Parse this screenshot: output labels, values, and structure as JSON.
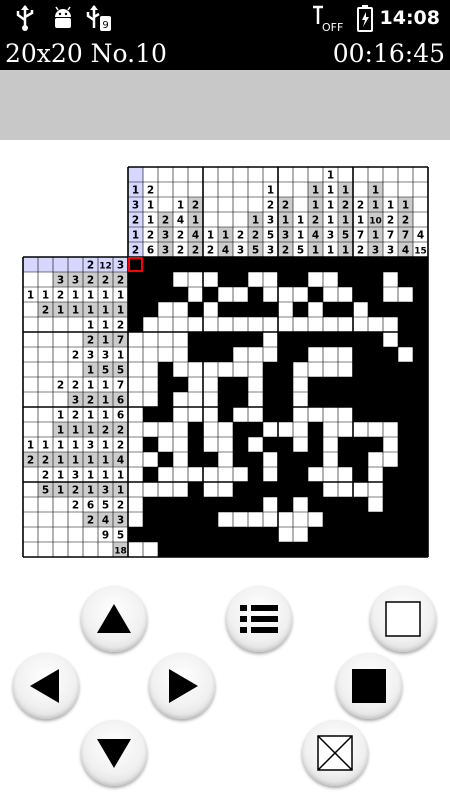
{
  "status_bar": {
    "time": "14:08",
    "icons": [
      "usb-icon",
      "android-debug-icon",
      "usb-storage-icon",
      "wifi-off-icon",
      "battery-charging-icon"
    ]
  },
  "header": {
    "title": "20x20 No.10",
    "timer": "00:16:45"
  },
  "board": {
    "size": 20,
    "column_clues": [
      [
        "1",
        "3",
        "2",
        "1",
        "2"
      ],
      [
        "2",
        "1",
        "1",
        "2",
        "6"
      ],
      [
        "2",
        "3",
        "3"
      ],
      [
        "1",
        "4",
        "2",
        "2"
      ],
      [
        "2",
        "1",
        "4",
        "2"
      ],
      [
        "1",
        "2"
      ],
      [
        "1",
        "4"
      ],
      [
        "2",
        "3"
      ],
      [
        "1",
        "2",
        "5"
      ],
      [
        "1",
        "2",
        "3",
        "5",
        "3"
      ],
      [
        "2",
        "1",
        "3",
        "2"
      ],
      [
        "1",
        "1",
        "5"
      ],
      [
        "1",
        "1",
        "2",
        "4",
        "1"
      ],
      [
        "1",
        "1",
        "1",
        "1",
        "3",
        "1"
      ],
      [
        "1",
        "2",
        "1",
        "5",
        "1"
      ],
      [
        "2",
        "1",
        "7",
        "2"
      ],
      [
        "1",
        "1",
        "10",
        "1",
        "3"
      ],
      [
        "1",
        "2",
        "7",
        "3"
      ],
      [
        "1",
        "2",
        "7",
        "4"
      ],
      [
        "4",
        "15"
      ]
    ],
    "row_clues": [
      [
        "2",
        "12",
        "3"
      ],
      [
        "3",
        "3",
        "2",
        "2",
        "2"
      ],
      [
        "1",
        "1",
        "2",
        "1",
        "1",
        "1",
        "1"
      ],
      [
        "2",
        "1",
        "1",
        "1",
        "1",
        "1"
      ],
      [
        "1",
        "1",
        "2"
      ],
      [
        "2",
        "1",
        "7"
      ],
      [
        "2",
        "3",
        "3",
        "1"
      ],
      [
        "1",
        "5",
        "5"
      ],
      [
        "2",
        "2",
        "1",
        "1",
        "7"
      ],
      [
        "3",
        "2",
        "1",
        "6"
      ],
      [
        "1",
        "2",
        "1",
        "1",
        "6"
      ],
      [
        "1",
        "1",
        "1",
        "2",
        "2"
      ],
      [
        "1",
        "1",
        "1",
        "1",
        "3",
        "1",
        "2"
      ],
      [
        "2",
        "2",
        "1",
        "1",
        "1",
        "1",
        "4"
      ],
      [
        "2",
        "1",
        "3",
        "1",
        "1",
        "1"
      ],
      [
        "5",
        "1",
        "2",
        "1",
        "3",
        "1"
      ],
      [
        "2",
        "6",
        "5",
        "2"
      ],
      [
        "2",
        "4",
        "3"
      ],
      [
        "9",
        "5"
      ],
      [
        "18"
      ]
    ],
    "solved_rows": [
      "11111111111111111111",
      "11100011001100111011",
      "11110100100010011001",
      "11001011110101101111",
      "10000000000000000011",
      "00001111101111111011",
      "00001110001100011101",
      "00100000011000011111",
      "00110011011011111111",
      "00100011011011111111",
      "01100010011000011111",
      "00001001100010000011",
      "01001001011010111011",
      "00101101101110110011",
      "01000000101100010111",
      "00001001111110000111",
      "01111111101011110111",
      "01111100000001111111",
      "11111111110011111111",
      "00111111111111111111"
    ],
    "cursor": {
      "row": 1,
      "col": 1
    },
    "colors": {
      "filled": "#000000",
      "empty": "#ffffff",
      "clue_shaded": "#cccccc",
      "clue_plain": "#ffffff",
      "highlight": "#d6d6ff",
      "cursor": "#ff0000",
      "grid": "#000000"
    }
  },
  "controls": [
    {
      "name": "up-button",
      "icon": "arrow-up"
    },
    {
      "name": "left-button",
      "icon": "arrow-left"
    },
    {
      "name": "right-button",
      "icon": "arrow-right"
    },
    {
      "name": "down-button",
      "icon": "arrow-down"
    },
    {
      "name": "menu-button",
      "icon": "list"
    },
    {
      "name": "clear-cell-button",
      "icon": "empty-square"
    },
    {
      "name": "fill-cell-button",
      "icon": "filled-square"
    },
    {
      "name": "mark-x-button",
      "icon": "crossed-square"
    }
  ]
}
